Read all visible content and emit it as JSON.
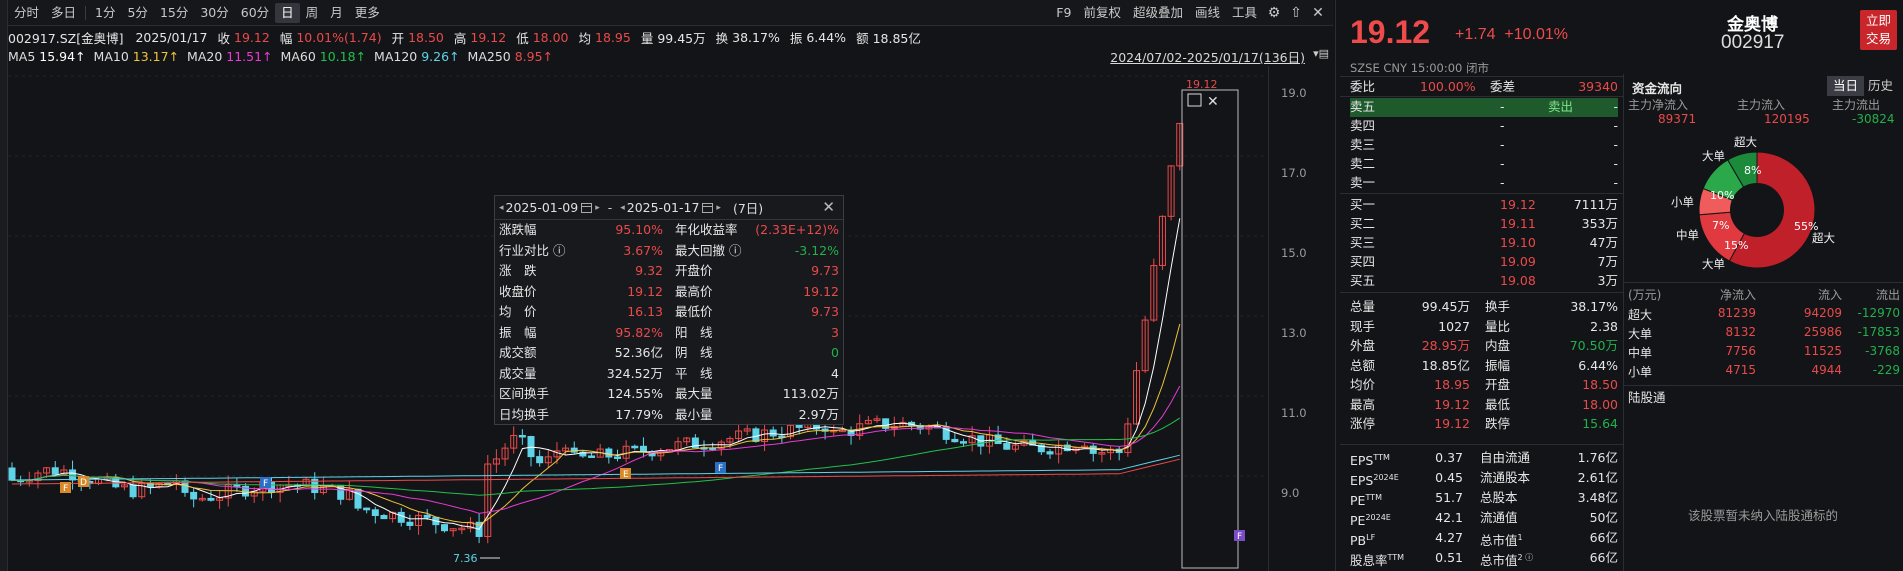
{
  "toolbar": {
    "periods": [
      "分时",
      "多日",
      "1分",
      "5分",
      "15分",
      "30分",
      "60分",
      "日",
      "周",
      "月",
      "更多"
    ],
    "active_period": "日",
    "right": [
      "F9",
      "前复权",
      "超级叠加",
      "画线",
      "工具"
    ]
  },
  "info": {
    "code": "002917.SZ[金奥博]",
    "date": "2025/01/17",
    "close_label": "收",
    "close": "19.12",
    "range_label": "幅",
    "range": "10.01%(1.74)",
    "open_label": "开",
    "open": "18.50",
    "high_label": "高",
    "high": "19.12",
    "low_label": "低",
    "low": "18.00",
    "avg_label": "均",
    "avg": "18.95",
    "vol_label": "量",
    "vol": "99.45万",
    "turn_label": "换",
    "turn": "38.17%",
    "amp_label": "振",
    "amp": "6.44%",
    "amt_label": "额",
    "amt": "18.85亿"
  },
  "ma": [
    {
      "label": "MA5",
      "value": "15.94↑",
      "color": "#ffffff"
    },
    {
      "label": "MA10",
      "value": "13.17↑",
      "color": "#f0c33c"
    },
    {
      "label": "MA20",
      "value": "11.51↑",
      "color": "#e83ad6"
    },
    {
      "label": "MA60",
      "value": "10.18↑",
      "color": "#22c04a"
    },
    {
      "label": "MA120",
      "value": "9.26↑",
      "color": "#5fd3e8"
    },
    {
      "label": "MA250",
      "value": "8.95↑",
      "color": "#e94a4a"
    }
  ],
  "range_text": "2024/07/02-2025/01/17(136日)",
  "axis_ticks": [
    "19.0",
    "17.0",
    "15.0",
    "13.0",
    "11.0",
    "9.0"
  ],
  "chart_labels": {
    "low": "7.36",
    "top": "19.12"
  },
  "popup": {
    "start": "2025-01-09",
    "end": "2025-01-17",
    "dash": "-",
    "days": "(7日)",
    "rows": [
      [
        [
          "涨跌幅",
          "95.10%",
          "red"
        ],
        [
          "年化收益率",
          "(2.33E+12)%",
          "red"
        ]
      ],
      [
        [
          "行业对比 ⓘ",
          "3.67%",
          "red"
        ],
        [
          "最大回撤 ⓘ",
          "-3.12%",
          "green"
        ]
      ],
      [
        [
          "涨　跌",
          "9.32",
          "red"
        ],
        [
          "开盘价",
          "9.73",
          "red"
        ]
      ],
      [
        [
          "收盘价",
          "19.12",
          "red"
        ],
        [
          "最高价",
          "19.12",
          "red"
        ]
      ],
      [
        [
          "均　价",
          "16.13",
          "red"
        ],
        [
          "最低价",
          "9.73",
          "red"
        ]
      ],
      [
        [
          "振　幅",
          "95.82%",
          "red"
        ],
        [
          "阳　线",
          "3",
          "red"
        ]
      ],
      [
        [
          "成交额",
          "52.36亿",
          "white"
        ],
        [
          "阴　线",
          "0",
          "green"
        ]
      ],
      [
        [
          "成交量",
          "324.52万",
          "white"
        ],
        [
          "平　线",
          "4",
          "white"
        ]
      ],
      [
        [
          "区间换手",
          "124.55%",
          "white"
        ],
        [
          "最大量",
          "113.02万",
          "white"
        ]
      ],
      [
        [
          "日均换手",
          "17.79%",
          "white"
        ],
        [
          "最小量",
          "2.97万",
          "white"
        ]
      ]
    ]
  },
  "quote": {
    "price": "19.12",
    "change": "+1.74",
    "pct": "+10.01%",
    "name": "金奥博",
    "code": "002917",
    "trade_btn": "立即\n交易",
    "market": "SZSE  CNY  15:00:00  闭市"
  },
  "orderbook": {
    "wb_label": "委比",
    "wb": "100.00%",
    "wc_label": "委差",
    "wc": "39340",
    "sells": [
      {
        "label": "卖五",
        "price": "-",
        "vol": "-",
        "tag": "卖出"
      },
      {
        "label": "卖四",
        "price": "-",
        "vol": "-"
      },
      {
        "label": "卖三",
        "price": "-",
        "vol": "-"
      },
      {
        "label": "卖二",
        "price": "-",
        "vol": "-"
      },
      {
        "label": "卖一",
        "price": "-",
        "vol": "-"
      }
    ],
    "buys": [
      {
        "label": "买一",
        "price": "19.12",
        "vol": "7111万"
      },
      {
        "label": "买二",
        "price": "19.11",
        "vol": "353万"
      },
      {
        "label": "买三",
        "price": "19.10",
        "vol": "47万"
      },
      {
        "label": "买四",
        "price": "19.09",
        "vol": "7万"
      },
      {
        "label": "买五",
        "price": "19.08",
        "vol": "3万"
      }
    ]
  },
  "stats": [
    [
      [
        "总量",
        "99.45万",
        "white"
      ],
      [
        "换手",
        "38.17%",
        "white"
      ]
    ],
    [
      [
        "现手",
        "1027",
        "white"
      ],
      [
        "量比",
        "2.38",
        "white"
      ]
    ],
    [
      [
        "外盘",
        "28.95万",
        "red"
      ],
      [
        "内盘",
        "70.50万",
        "green"
      ]
    ],
    [
      [
        "总额",
        "18.85亿",
        "white"
      ],
      [
        "振幅",
        "6.44%",
        "white"
      ]
    ],
    [
      [
        "均价",
        "18.95",
        "red"
      ],
      [
        "开盘",
        "18.50",
        "red"
      ]
    ],
    [
      [
        "最高",
        "19.12",
        "red"
      ],
      [
        "最低",
        "18.00",
        "red"
      ]
    ],
    [
      [
        "涨停",
        "19.12",
        "red"
      ],
      [
        "跌停",
        "15.64",
        "green"
      ]
    ]
  ],
  "fundamentals": [
    [
      [
        "EPS",
        "TTM",
        "0.37"
      ],
      [
        "自由流通",
        "",
        "1.76亿"
      ]
    ],
    [
      [
        "EPS",
        "2024E",
        "0.45"
      ],
      [
        "流通股本",
        "",
        "2.61亿"
      ]
    ],
    [
      [
        "PE",
        "TTM",
        "51.7"
      ],
      [
        "总股本",
        "",
        "3.48亿"
      ]
    ],
    [
      [
        "PE",
        "2024E",
        "42.1"
      ],
      [
        "流通值",
        "",
        "50亿"
      ]
    ],
    [
      [
        "PB",
        "LF",
        "4.27"
      ],
      [
        "总市值",
        "1",
        "66亿"
      ]
    ],
    [
      [
        "股息率",
        "TTM",
        "0.51"
      ],
      [
        "总市值",
        "2 ⓘ",
        "66亿"
      ]
    ]
  ],
  "flow": {
    "title": "资金流向",
    "tabs": [
      "当日",
      "历史"
    ],
    "active_tab": "当日",
    "heads": [
      "主力净流入",
      "主力流入",
      "主力流出"
    ],
    "vals": [
      "89371",
      "120195",
      "-30824"
    ],
    "donut_labels": {
      "cd1": "超大",
      "big1": "大单",
      "small1": "小单",
      "mid": "中单",
      "big2": "大单",
      "cd2": "超大"
    },
    "table_head": [
      "(万元)",
      "净流入",
      "流入",
      "流出"
    ],
    "table": [
      [
        "超大",
        "81239",
        "94209",
        "-12970"
      ],
      [
        "大单",
        "8132",
        "25986",
        "-17853"
      ],
      [
        "中单",
        "7756",
        "11525",
        "-3768"
      ],
      [
        "小单",
        "4715",
        "4944",
        "-229"
      ]
    ],
    "lgt_title": "陆股通",
    "lgt_msg": "该股票暂未纳入陆股通标的"
  },
  "chart_data": {
    "type": "candlestick",
    "ylim": [
      7.0,
      19.5
    ],
    "slices": [
      {
        "label": "超大",
        "pct": 55,
        "color": "#c0202a"
      },
      {
        "label": "大单",
        "pct": 15,
        "color": "#e0393f"
      },
      {
        "label": "中单",
        "pct": 7,
        "color": "#f05b5b"
      },
      {
        "label": "小单",
        "pct": 10,
        "color": "#2aa84a"
      },
      {
        "label": "大单",
        "pct": 8,
        "color": "#1c8a3a"
      }
    ],
    "slice_pcts": [
      "55%",
      "15%",
      "7%",
      "10%",
      "8%"
    ]
  },
  "colors": {
    "up": "#e94a4a",
    "down": "#5fd3e8",
    "bg": "#131417"
  }
}
